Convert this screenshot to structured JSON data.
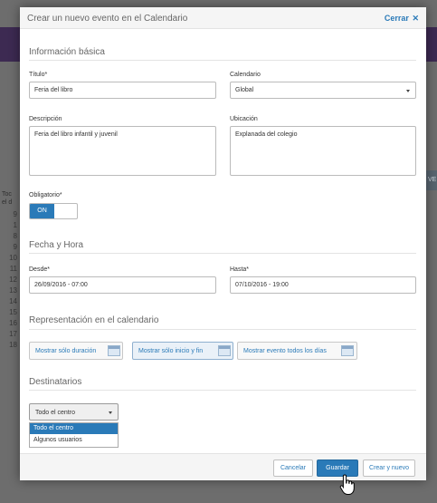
{
  "background": {
    "row_numbers": [
      "9",
      "1",
      "8",
      "9",
      "10",
      "11",
      "12",
      "13",
      "14",
      "15",
      "16",
      "17",
      "18"
    ],
    "side_text": [
      "Toc",
      "el d"
    ],
    "right_header": "VE"
  },
  "modal": {
    "title": "Crear un nuevo evento en el Calendario",
    "close_label": "Cerrar",
    "close_icon": "close-icon"
  },
  "basic": {
    "section_title": "Información básica",
    "title_label": "Título*",
    "title_value": "Feria del libro",
    "calendar_label": "Calendario",
    "calendar_value": "Global",
    "description_label": "Descripción",
    "description_value": "Feria del libro infantil y juvenil",
    "location_label": "Ubicación",
    "location_value": "Explanada del colegio",
    "mandatory_label": "Obligatorio*",
    "mandatory_toggle": "ON"
  },
  "datetime": {
    "section_title": "Fecha y Hora",
    "from_label": "Desde*",
    "from_value": "26/09/2016 - 07:00",
    "to_label": "Hasta*",
    "to_value": "07/10/2016 - 19:00"
  },
  "representation": {
    "section_title": "Representación en el calendario",
    "options": [
      "Mostrar sólo duración",
      "Mostrar sólo inicio y fin",
      "Mostrar evento todos los días"
    ]
  },
  "recipients": {
    "section_title": "Destinatarios",
    "selected": "Todo el centro",
    "options": [
      "Todo el centro",
      "Algunos usuarios"
    ]
  },
  "footer": {
    "cancel_label": "Cancelar",
    "save_label": "Guardar",
    "save_new_label": "Crear y nuevo"
  },
  "colors": {
    "accent": "#2a7ab8",
    "overlay": "#6d6d6d"
  }
}
